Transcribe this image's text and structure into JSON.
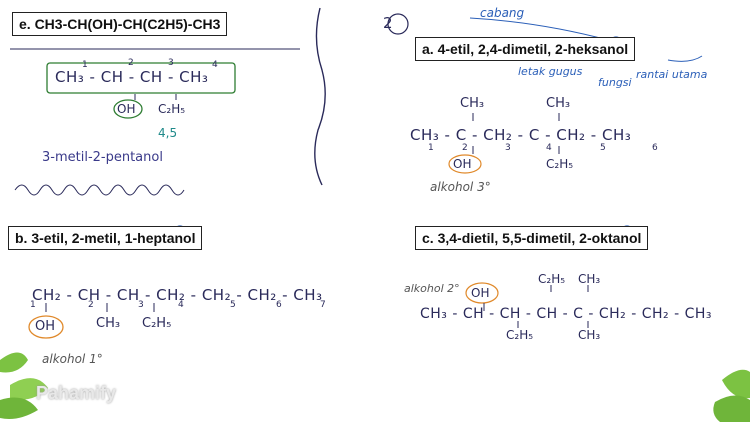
{
  "section_e": {
    "title": "e. CH3-CH(OH)-CH(C2H5)-CH3",
    "main_chain": "CH₃ - CH - CH - CH₃",
    "numbers": [
      "1",
      "2",
      "3",
      "4"
    ],
    "subst_oh": "OH",
    "subst_c2h5": "C₂H₅",
    "locants": "4,5",
    "answer": "3-metil-2-pentanol",
    "circle_number": "2"
  },
  "section_a": {
    "title": "a. 4-etil, 2,4-dimetil, 2-heksanol",
    "note_cabang": "cabang",
    "note_letak": "letak gugus",
    "note_fungsi": "fungsi",
    "note_rantai": "rantai utama",
    "top_ch3_1": "CH₃",
    "top_ch3_2": "CH₃",
    "main_chain": "CH₃ - C - CH₂ - C - CH₂ - CH₃",
    "chain_numbers": [
      "1",
      "2",
      "3",
      "4",
      "5",
      "6"
    ],
    "subst_oh": "OH",
    "subst_c2h5": "C₂H₅",
    "alcohol_type": "alkohol 3°"
  },
  "section_b": {
    "title": "b. 3-etil, 2-metil, 1-heptanol",
    "main_chain": "CH₂ - CH - CH - CH₂ - CH₂ - CH₂ - CH₃",
    "chain_numbers": [
      "1",
      "2",
      "3",
      "4",
      "5",
      "6",
      "7"
    ],
    "subst_oh": "OH",
    "subst_ch3": "CH₃",
    "subst_c2h5": "C₂H₅",
    "alcohol_type": "alkohol 1°"
  },
  "section_c": {
    "title": "c. 3,4-dietil, 5,5-dimetil, 2-oktanol",
    "alcohol_type": "alkohol 2°",
    "subst_oh": "OH",
    "top_c2h5": "C₂H₅",
    "top_ch3": "CH₃",
    "main_chain": "CH₃ - CH - CH - CH - C - CH₂ - CH₂ - CH₃",
    "bottom_c2h5": "C₂H₅",
    "bottom_ch3": "CH₃"
  },
  "brand": {
    "logo_text": "Pahamify"
  },
  "colors": {
    "ink": "#2a2a5a",
    "blue": "#2b5fb8",
    "teal": "#1f8a8a",
    "green": "#7cc242"
  }
}
